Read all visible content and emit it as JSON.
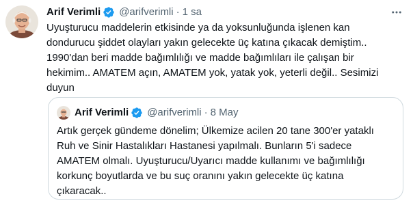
{
  "tweet": {
    "author_name": "Arif Verimli",
    "handle": "@arifverimli",
    "separator": "·",
    "time": "1 sa",
    "more_icon": "more-horizontal-icon",
    "text": "Uyuşturucu maddelerin etkisinde ya da yoksunluğunda işlenen kan\ndondurucu şiddet olayları yakın gelecekte üç katına çıkacak demiştim..\n1990'dan beri madde bağımlılığı ve madde bağımlıları ile çalışan bir\nhekimim.. AMATEM açın, AMATEM yok, yatak yok, yeterli değil.. Sesimizi\nduyun"
  },
  "quote": {
    "author_name": "Arif Verimli",
    "handle": "@arifverimli",
    "separator": "·",
    "time": "8 May",
    "text": "Artık gerçek gündeme dönelim; Ülkemize acilen 20 tane 300'er yataklı\nRuh ve Sinir Hastalıkları Hastanesi yapılmalı. Bunların 5'i sadece\nAMATEM olmalı. Uyuşturucu/Uyarıcı madde kullanımı ve bağımlılığı\nkorkunç boyutlarda ve bu suç oranını yakın gelecekte üç katına\nçıkaracak.."
  },
  "colors": {
    "text_primary": "#0f1419",
    "text_secondary": "#536471",
    "verified_blue": "#1d9bf0",
    "border": "#cfd9de"
  }
}
